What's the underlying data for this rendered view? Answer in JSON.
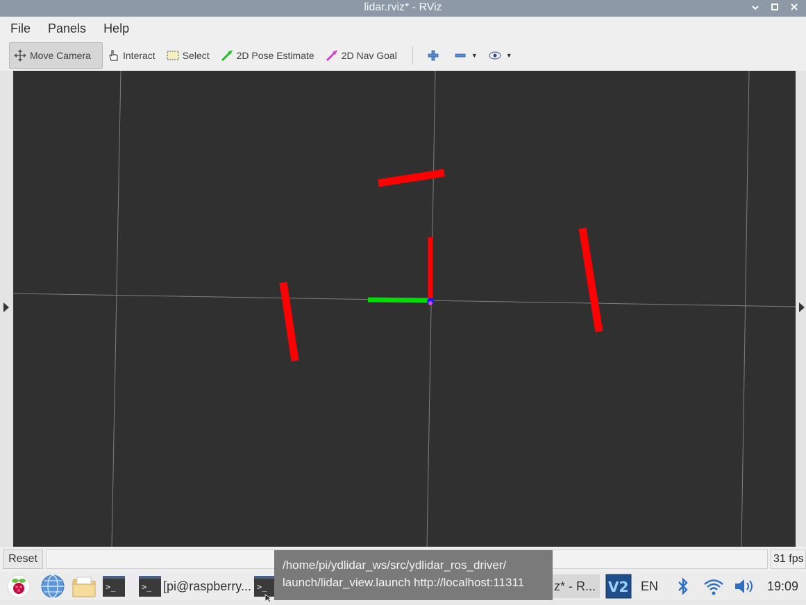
{
  "window": {
    "title": "lidar.rviz* - RViz"
  },
  "menu": {
    "file": "File",
    "panels": "Panels",
    "help": "Help"
  },
  "toolbar": {
    "move_camera": "Move Camera",
    "interact": "Interact",
    "select": "Select",
    "pose_estimate": "2D Pose Estimate",
    "nav_goal": "2D Nav Goal"
  },
  "status": {
    "reset": "Reset",
    "fps": "31 fps"
  },
  "taskbar": {
    "terminal_task": "[pi@raspberry...",
    "rviz_task": "z* - R...",
    "lang": "EN",
    "clock": "19:09"
  },
  "tooltip": {
    "line1": "/home/pi/ydlidar_ws/src/ydlidar_ros_driver/",
    "line2": "launch/lidar_view.launch http://localhost:11311"
  },
  "colors": {
    "scan": "#ff0000",
    "axis_x": "#ff0000",
    "axis_y": "#00dd00",
    "background": "#303030",
    "grid": "#8a8a8a"
  }
}
